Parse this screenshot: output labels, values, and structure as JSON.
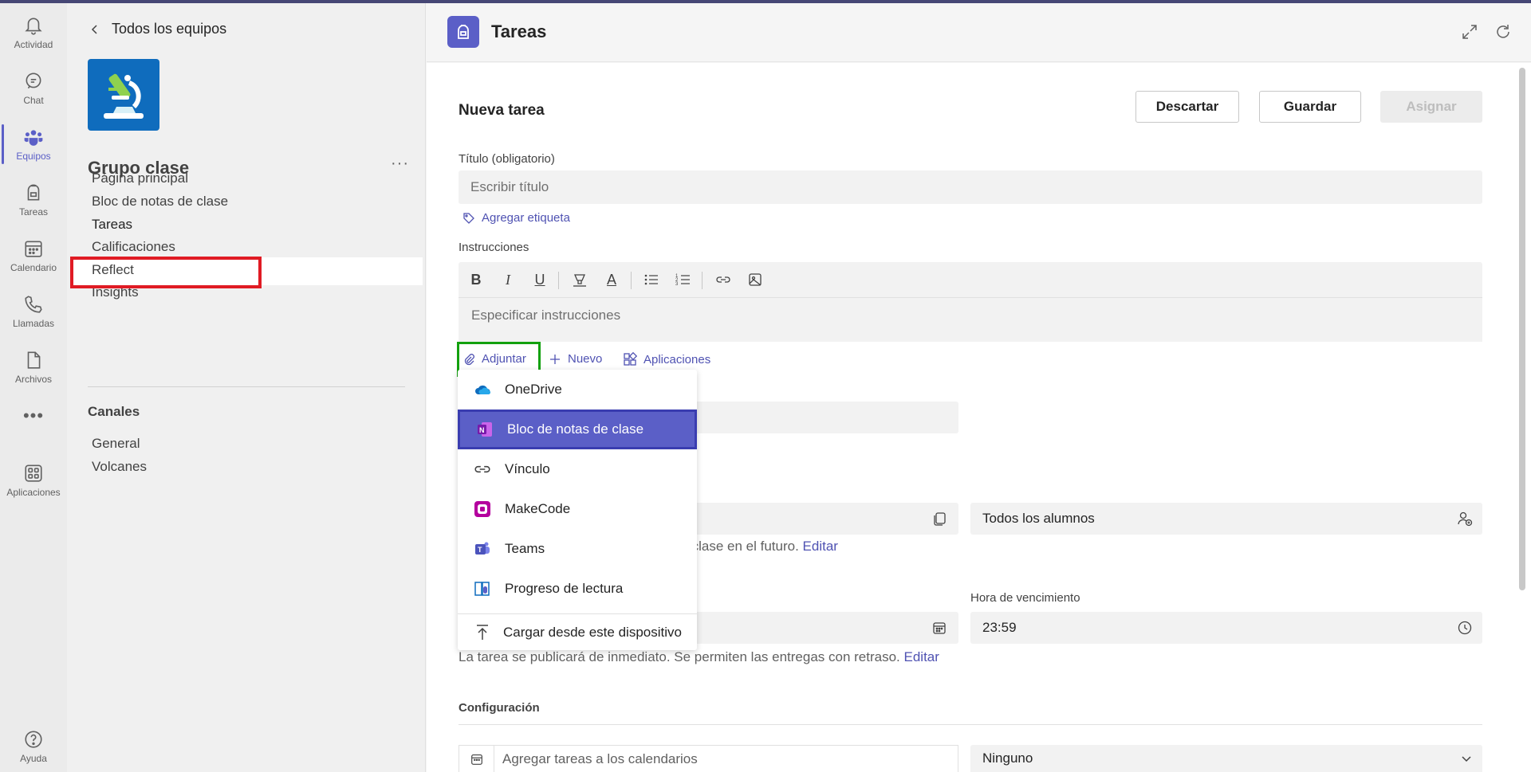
{
  "rail": [
    {
      "label": "Actividad",
      "icon": "bell-icon"
    },
    {
      "label": "Chat",
      "icon": "chat-icon"
    },
    {
      "label": "Equipos",
      "icon": "teams-icon"
    },
    {
      "label": "Tareas",
      "icon": "backpack-icon"
    },
    {
      "label": "Calendario",
      "icon": "calendar-icon"
    },
    {
      "label": "Llamadas",
      "icon": "phone-icon"
    },
    {
      "label": "Archivos",
      "icon": "file-icon"
    },
    {
      "label": "Aplicaciones",
      "icon": "apps-icon"
    },
    {
      "label": "Ayuda",
      "icon": "help-icon"
    }
  ],
  "team": {
    "back_label": "Todos los equipos",
    "name": "Grupo clase",
    "nav": [
      "Página principal",
      "Bloc de notas de clase",
      "Tareas",
      "Calificaciones",
      "Reflect",
      "Insights"
    ],
    "selected": "Tareas",
    "channels_title": "Canales",
    "channels": [
      "General",
      "Volcanes"
    ]
  },
  "header": {
    "title": "Tareas"
  },
  "form": {
    "heading": "Nueva tarea",
    "discard": "Descartar",
    "save": "Guardar",
    "assign": "Asignar",
    "title_label": "Título (obligatorio)",
    "title_placeholder": "Escribir título",
    "add_tag": "Agregar etiqueta",
    "instructions_label": "Instrucciones",
    "instructions_placeholder": "Especificar instrucciones",
    "attach": "Adjuntar",
    "new": "Nuevo",
    "apps": "Aplicaciones",
    "students": "Todos los alumnos",
    "assign_hint": "ados a esta clase en el futuro.",
    "assign_edit": "Editar",
    "due_time_label": "Hora de vencimiento",
    "due_time": "23:59",
    "publish_hint": "La tarea se publicará de inmediato. Se permiten las entregas con retraso.",
    "publish_edit": "Editar",
    "config_label": "Configuración",
    "calendar_label": "Agregar tareas a los calendarios",
    "calendar_value": "Ninguno"
  },
  "menu": [
    {
      "label": "OneDrive",
      "icon": "onedrive-icon"
    },
    {
      "label": "Bloc de notas de clase",
      "icon": "onenote-icon"
    },
    {
      "label": "Vínculo",
      "icon": "link-icon"
    },
    {
      "label": "MakeCode",
      "icon": "makecode-icon"
    },
    {
      "label": "Teams",
      "icon": "teams-icon"
    },
    {
      "label": "Progreso de lectura",
      "icon": "reading-progress-icon"
    },
    {
      "label": "Cargar desde este dispositivo",
      "icon": "upload-icon"
    }
  ],
  "colors": {
    "accent": "#5b5fc7",
    "highlight_red": "#e01b24",
    "highlight_green": "#13a10e"
  }
}
